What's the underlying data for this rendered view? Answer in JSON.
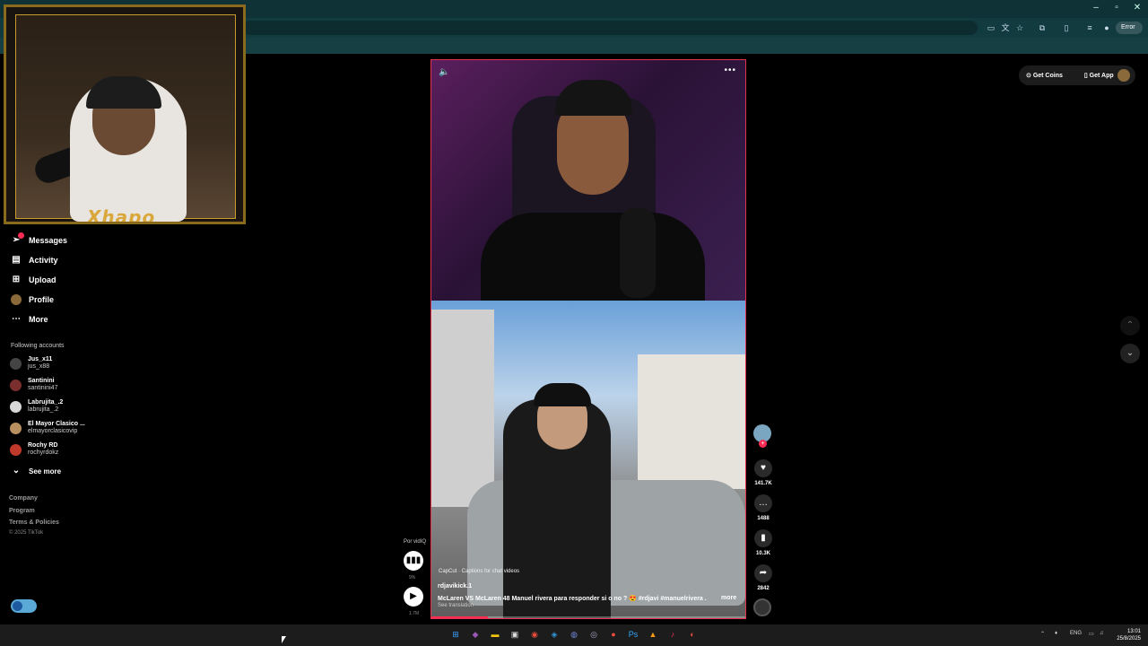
{
  "browser": {
    "profile_label": "Error",
    "window_controls": [
      "–",
      "▫",
      "✕"
    ]
  },
  "webcam": {
    "logo_text": "Xhapo"
  },
  "nav": {
    "items": [
      {
        "label": "Messages",
        "icon": "paper-plane-icon"
      },
      {
        "label": "Activity",
        "icon": "inbox-icon"
      },
      {
        "label": "Upload",
        "icon": "plus-box-icon"
      },
      {
        "label": "Profile",
        "icon": "avatar-icon"
      },
      {
        "label": "More",
        "icon": "dots-icon"
      }
    ],
    "following_title": "Following accounts",
    "accounts": [
      {
        "name": "Jus_x11",
        "username": "jus_x88",
        "color": "#444444"
      },
      {
        "name": "Santinini",
        "username": "santinini47",
        "color": "#7a2e2e"
      },
      {
        "name": "Labrujita_.2",
        "username": "labrujita_.2",
        "color": "#d8d8d8"
      },
      {
        "name": "El Mayor Clasico ...",
        "username": "elmayorclasicovip",
        "color": "#b89060"
      },
      {
        "name": "Rochy RD",
        "username": "rochyrdokz",
        "color": "#c0392b"
      }
    ],
    "see_more": "See more",
    "footer": [
      "Company",
      "Program",
      "Terms & Policies"
    ],
    "copyright": "© 2025 TikTok"
  },
  "top_actions": {
    "get_coins": "Get Coins",
    "get_app": "Get App"
  },
  "video": {
    "capcut": "CapCut · Captions for chat videos",
    "author": "rdjavikick.1",
    "caption": "McLaren VS McLaren 48 Manuel rivera para responder si o no ? 😍 #rdjavi  #manuelrivera ...",
    "more_label": "more",
    "translation": "See translation",
    "progress_percent": 18
  },
  "actions": {
    "likes": "141.7K",
    "comments": "1488",
    "saves": "10.3K",
    "shares": "2842"
  },
  "mini": {
    "label": "Por vidIQ",
    "stat1": "9%",
    "stat2": "1.7M"
  },
  "taskbar": {
    "language": "ENG",
    "time": "13:01",
    "date": "25/8/2025"
  },
  "colors": {
    "accent": "#fe2c55",
    "chrome_bg": "#0f3236"
  }
}
